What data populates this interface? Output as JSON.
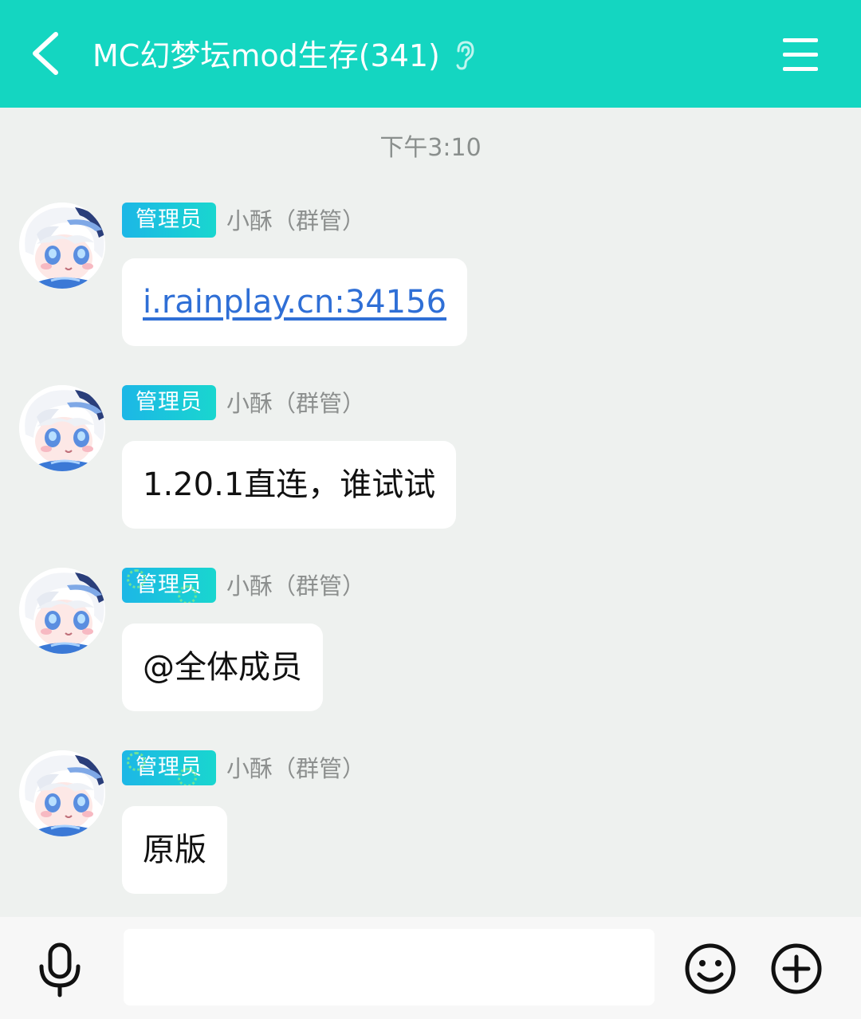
{
  "header": {
    "title": "MC幻梦坛mod生存(341)",
    "back_icon": "chevron-left-icon",
    "listen_icon": "ear-icon",
    "menu_icon": "hamburger-menu-icon",
    "bar_color": "#14d6c1"
  },
  "chat": {
    "timestamp": "下午3:10",
    "messages": [
      {
        "badge": "管理员",
        "sender": "小酥（群管）",
        "text": "i.rainplay.cn:34156",
        "is_link": true
      },
      {
        "badge": "管理员",
        "sender": "小酥（群管）",
        "text": "1.20.1直连，谁试试",
        "is_link": false
      },
      {
        "badge": "管理员",
        "sender": "小酥（群管）",
        "text": "@全体成员",
        "is_link": false
      },
      {
        "badge": "管理员",
        "sender": "小酥（群管）",
        "text": "原版",
        "is_link": false
      }
    ]
  },
  "input_bar": {
    "mic_icon": "microphone-icon",
    "input_value": "",
    "input_placeholder": "",
    "emoji_icon": "smiley-icon",
    "plus_icon": "plus-circle-icon"
  },
  "colors": {
    "link": "#2f6fd6",
    "badge_gradient_start": "#1cb7e6",
    "badge_gradient_end": "#19d6cf",
    "background": "#eef1ef"
  }
}
